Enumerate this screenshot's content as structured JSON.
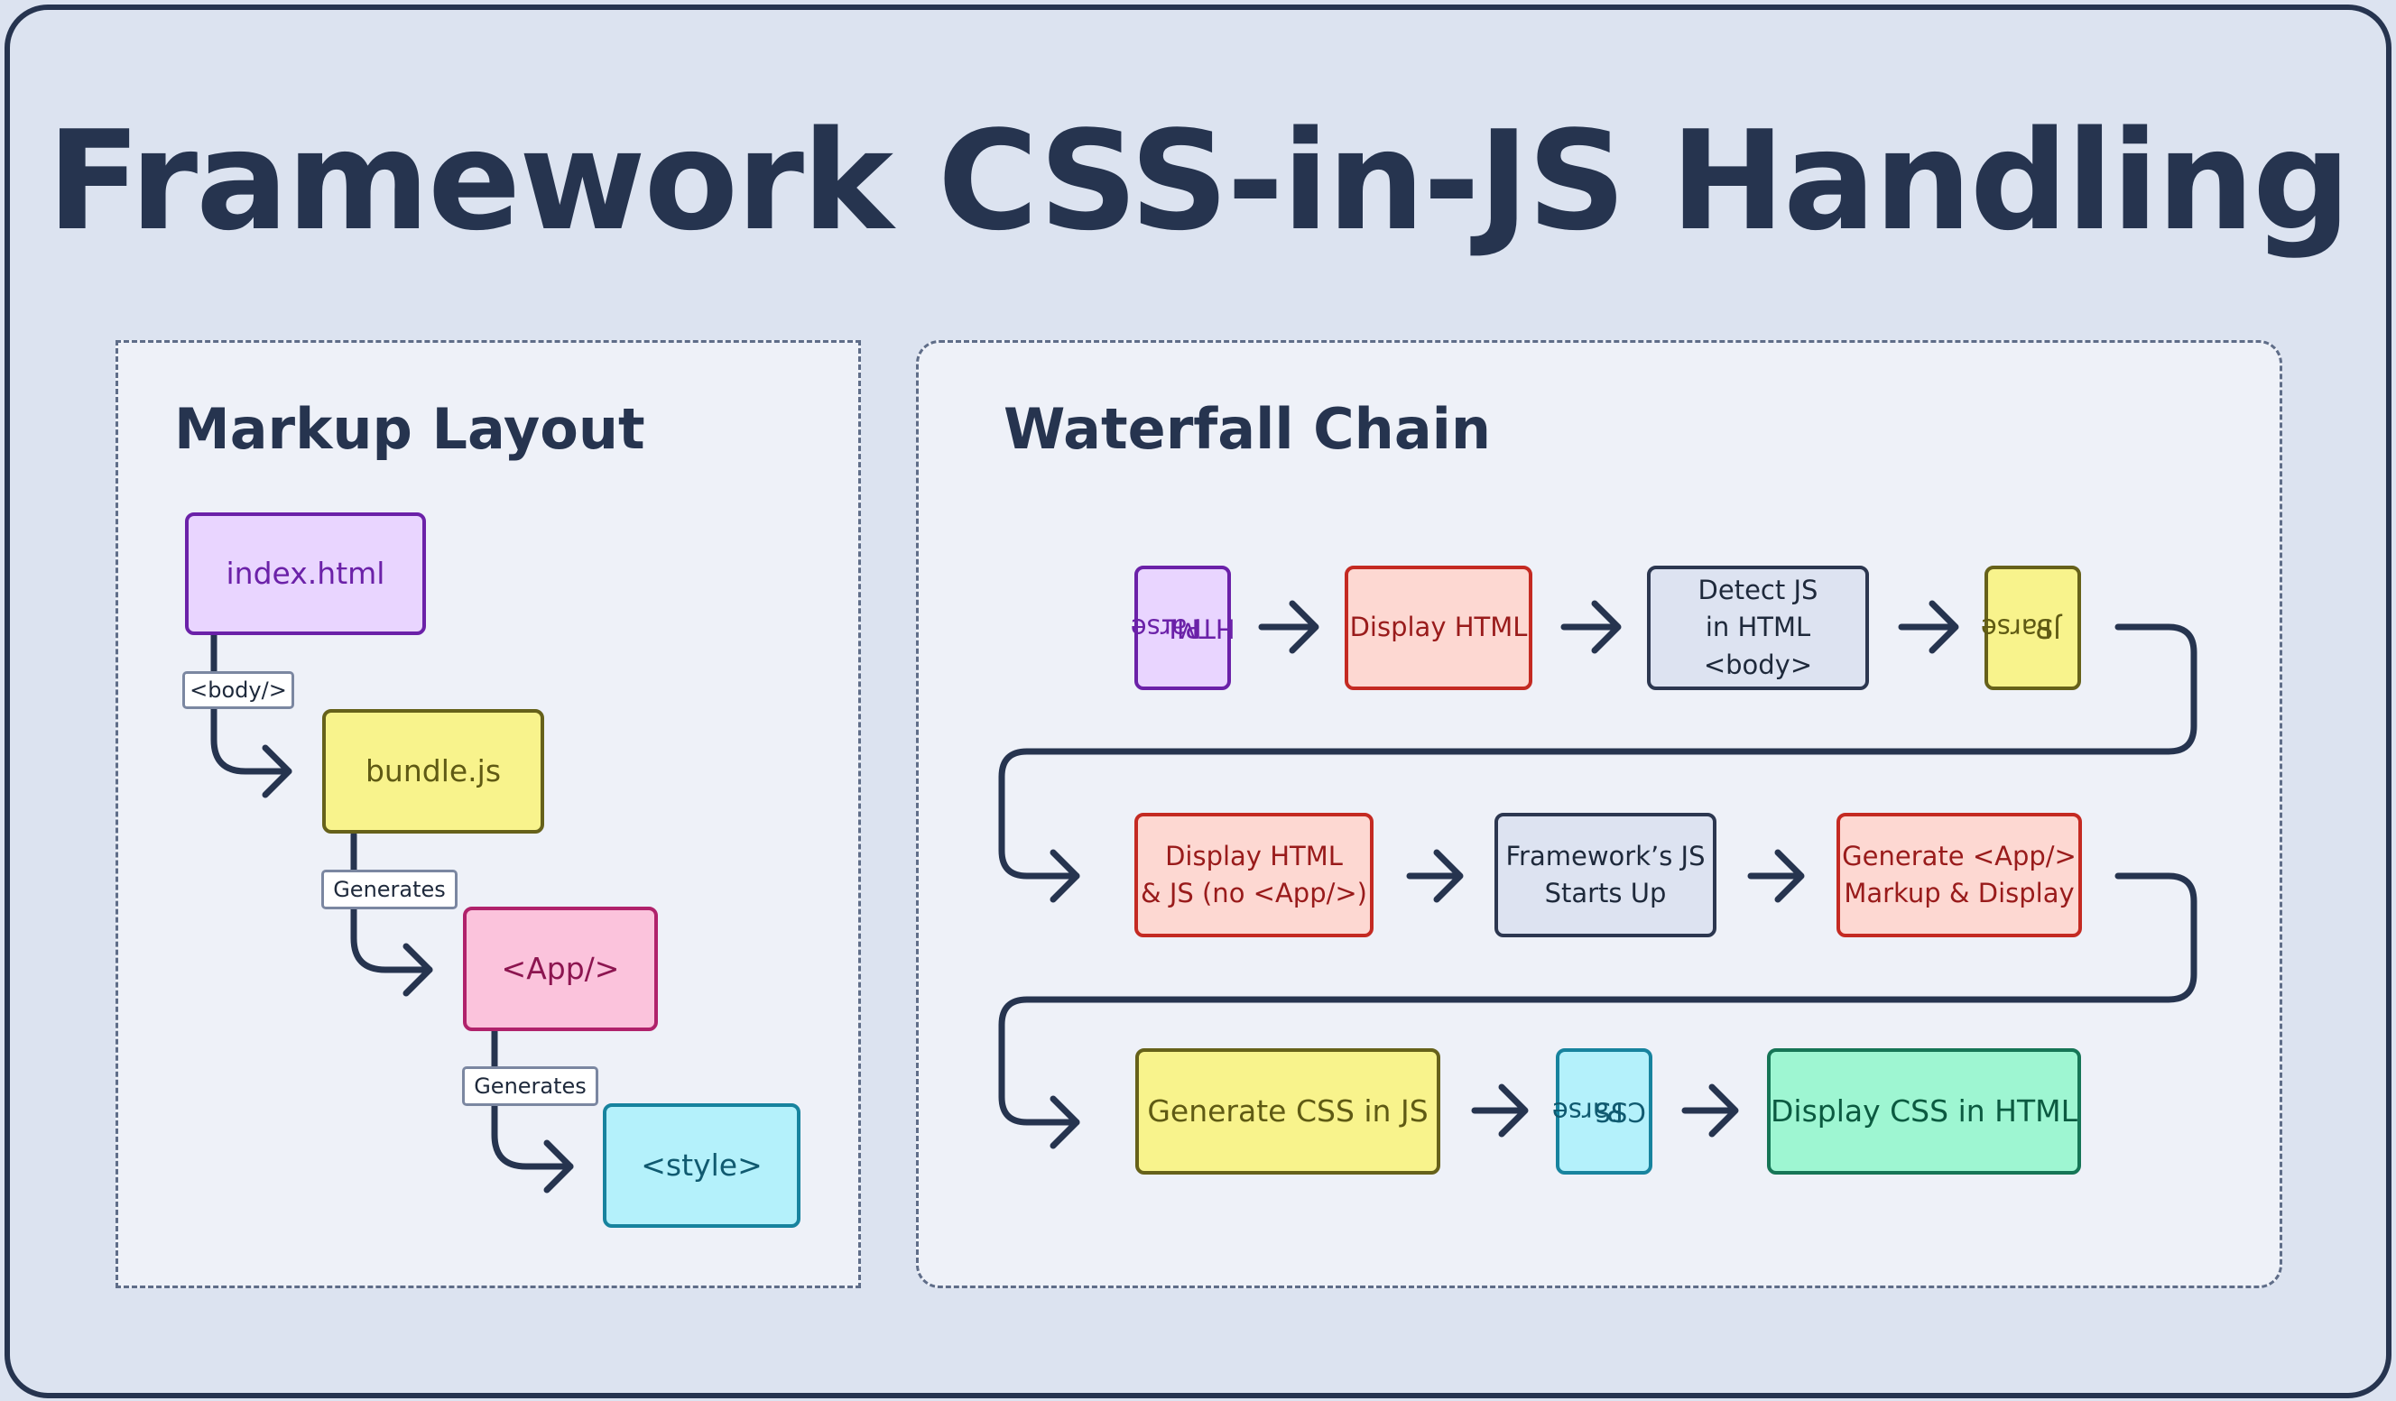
{
  "title": "Framework CSS-in-JS Handling",
  "markup_layout": {
    "heading": "Markup Layout",
    "nodes": {
      "index_html": "index.html",
      "bundle_js": "bundle.js",
      "app": "<App/>",
      "style": "<style>"
    },
    "edges": {
      "body": "<body/>",
      "generates_1": "Generates",
      "generates_2": "Generates"
    }
  },
  "waterfall_chain": {
    "heading": "Waterfall Chain",
    "row1": {
      "parse_html": [
        "Parse",
        "HTML"
      ],
      "display_html": "Display HTML",
      "detect_js": [
        "Detect JS",
        "in HTML <body>"
      ],
      "parse_js": [
        "Parse",
        "JS"
      ]
    },
    "row2": {
      "display_html_js": [
        "Display HTML",
        "& JS (no <App/>)"
      ],
      "framework_js": [
        "Framework’s JS",
        "Starts Up"
      ],
      "generate_app": [
        "Generate <App/>",
        "Markup & Display"
      ]
    },
    "row3": {
      "generate_css": "Generate CSS in JS",
      "parse_css": [
        "Parse",
        "CSS"
      ],
      "display_css": "Display CSS in HTML"
    }
  },
  "colors": {
    "ink": "#26344f",
    "background": "#dce3f0",
    "panel": "#eef1f8",
    "purple": "#e9d5ff",
    "yellow": "#f8f38c",
    "pink": "#fbc3dc",
    "cyan": "#b4f1fb",
    "red": "#fdd8d2",
    "slate": "#dde3f1",
    "green": "#9ef6d2"
  }
}
